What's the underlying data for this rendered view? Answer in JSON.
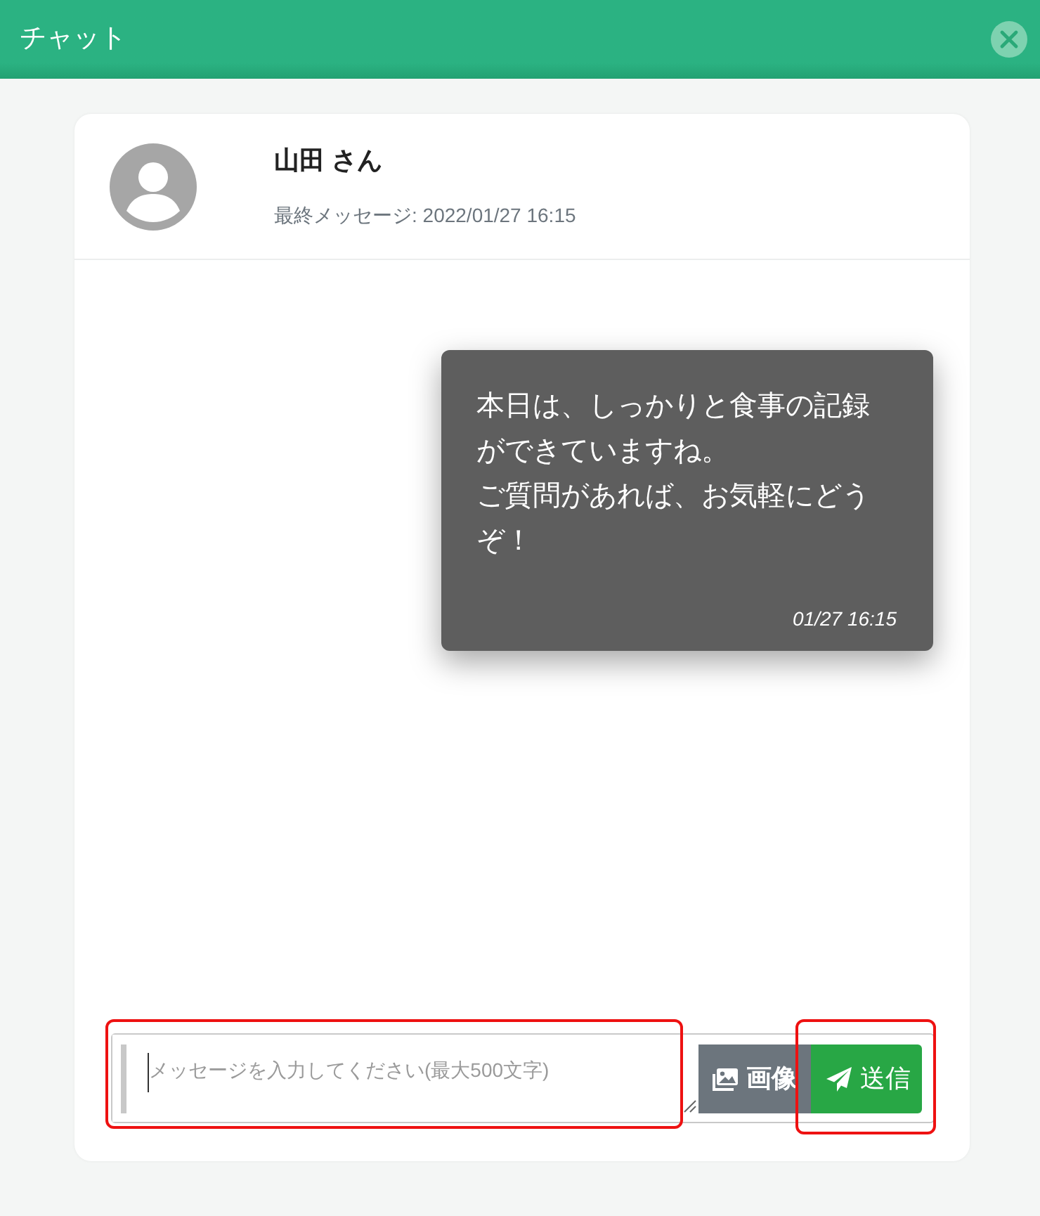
{
  "window": {
    "title": "チャット"
  },
  "contact": {
    "name": "山田 さん",
    "last_message": "最終メッセージ: 2022/01/27 16:15"
  },
  "messages": [
    {
      "paragraphs": [
        "本日は、しっかりと食事の記録ができていますね。",
        "ご質問があれば、お気軽にどうぞ！"
      ],
      "time": "01/27 16:15",
      "outgoing": true
    }
  ],
  "composer": {
    "placeholder": "メッセージを入力してください(最大500文字)",
    "focused": true,
    "highlighted": true
  },
  "buttons": [
    {
      "kind": "image",
      "label": "画像",
      "highlighted": false
    },
    {
      "kind": "send",
      "label": "送信",
      "highlighted": true
    }
  ]
}
